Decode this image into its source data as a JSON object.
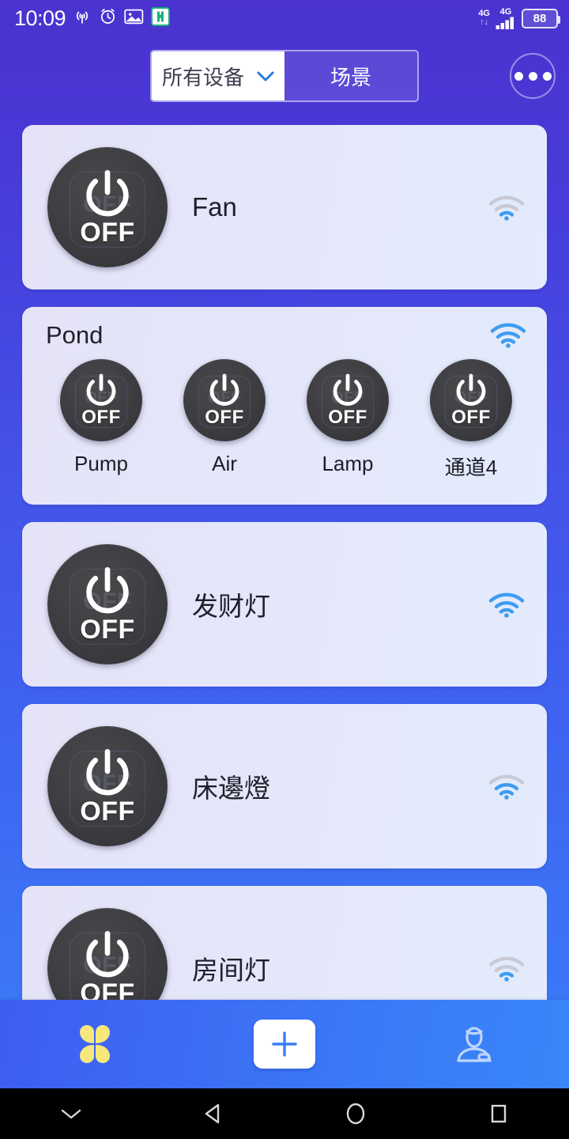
{
  "status_bar": {
    "time": "10:09",
    "icons": [
      "hotspot-icon",
      "alarm-icon",
      "screenshot-icon",
      "app-icon"
    ],
    "network_label": "4G",
    "network_label_2": "4G",
    "battery_percent": "88"
  },
  "top_bar": {
    "tabs": [
      {
        "label": "所有设备",
        "active": true,
        "has_chevron": true
      },
      {
        "label": "场景",
        "active": false,
        "has_chevron": false
      }
    ],
    "more_button": "more-options-icon"
  },
  "devices": [
    {
      "type": "single",
      "name": "Fan",
      "power_state": "OFF",
      "wifi_strength": "weak"
    },
    {
      "type": "group",
      "name": "Pond",
      "wifi_strength": "strong",
      "channels": [
        {
          "label": "Pump",
          "power_state": "OFF"
        },
        {
          "label": "Air",
          "power_state": "OFF"
        },
        {
          "label": "Lamp",
          "power_state": "OFF"
        },
        {
          "label": "通道4",
          "power_state": "OFF"
        }
      ]
    },
    {
      "type": "single",
      "name": "发财灯",
      "power_state": "OFF",
      "wifi_strength": "strong"
    },
    {
      "type": "single",
      "name": "床邊燈",
      "power_state": "OFF",
      "wifi_strength": "medium"
    },
    {
      "type": "single",
      "name": "房间灯",
      "power_state": "OFF",
      "wifi_strength": "weak"
    }
  ],
  "bottom_nav": [
    {
      "icon": "flower-home-icon",
      "active": true
    },
    {
      "icon": "plus-icon",
      "active": false
    },
    {
      "icon": "profile-icon",
      "active": false
    }
  ],
  "system_nav": [
    "chevron-down-icon",
    "back-icon",
    "home-icon",
    "recents-icon"
  ],
  "colors": {
    "background_top": "#4a33cf",
    "background_bottom": "#3a80f8",
    "card": "#e4e6f9",
    "knob": "#3d3d41",
    "wifi_active": "#3e9cf0",
    "wifi_inactive": "#c9c9d6",
    "accent_yellow": "#f6e67a",
    "nav_bar": "#3a78f7"
  }
}
